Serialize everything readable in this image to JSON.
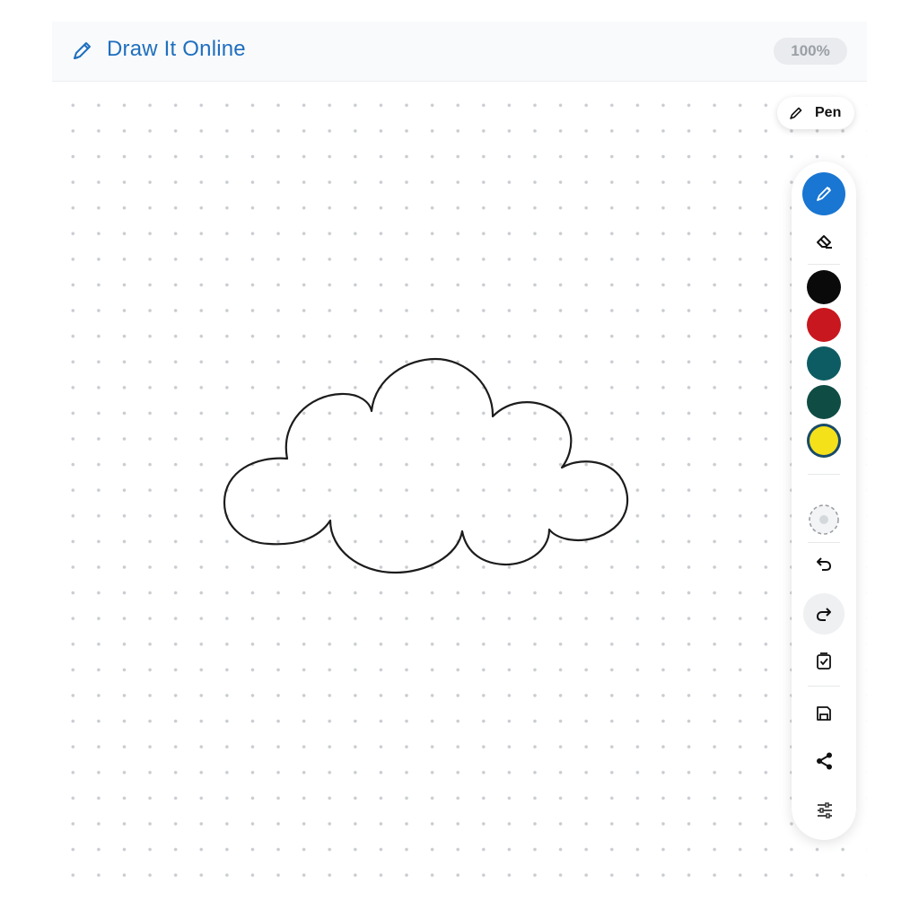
{
  "header": {
    "title": "Draw It Online",
    "brand_icon": "pencil-icon",
    "zoom_label": "100%"
  },
  "active_tool": {
    "label": "Pen",
    "icon": "pencil-icon"
  },
  "toolbar": {
    "tools": [
      {
        "name": "pen",
        "icon": "pen-icon",
        "active": true
      },
      {
        "name": "eraser",
        "icon": "eraser-icon",
        "active": false
      }
    ],
    "colors": [
      {
        "name": "black",
        "hex": "#0a0a0a"
      },
      {
        "name": "red",
        "hex": "#c8171e"
      },
      {
        "name": "teal",
        "hex": "#0d5c63"
      },
      {
        "name": "dark-green",
        "hex": "#0f4d44"
      },
      {
        "name": "yellow",
        "hex": "#f4e11a",
        "selected": true
      }
    ],
    "actions": [
      {
        "name": "brush-size",
        "icon": "brush-size-icon"
      },
      {
        "name": "undo",
        "icon": "undo-icon"
      },
      {
        "name": "redo",
        "icon": "redo-icon"
      },
      {
        "name": "clear",
        "icon": "clear-icon"
      },
      {
        "name": "save",
        "icon": "save-icon"
      },
      {
        "name": "share",
        "icon": "share-icon"
      },
      {
        "name": "settings",
        "icon": "sliders-icon"
      }
    ]
  },
  "canvas": {
    "background": "dot-grid",
    "drawing": "cloud-outline"
  },
  "accent_color": "#1976d2"
}
